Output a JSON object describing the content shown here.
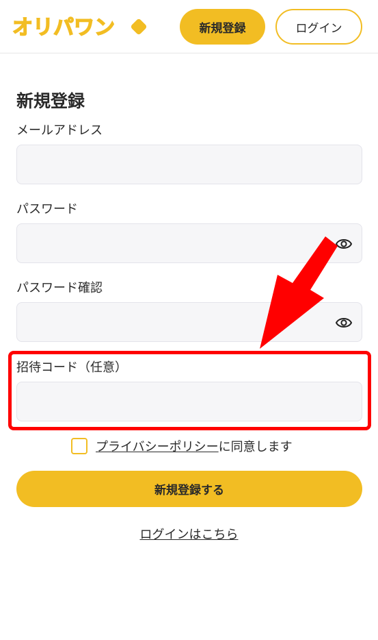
{
  "header": {
    "logo_text": "オリパワン",
    "register_label": "新規登録",
    "login_label": "ログイン"
  },
  "form": {
    "title": "新規登録",
    "email_label": "メールアドレス",
    "password_label": "パスワード",
    "password_confirm_label": "パスワード確認",
    "invite_code_label": "招待コード（任意）",
    "consent_link": "プライバシーポリシー",
    "consent_text": "に同意します",
    "submit_label": "新規登録する",
    "login_link": "ログインはこちら"
  },
  "colors": {
    "accent": "#f2bd23",
    "annotation": "#ff0000"
  },
  "icons": {
    "password_toggle": "eye-icon",
    "annotation_arrow": "arrow-icon"
  }
}
